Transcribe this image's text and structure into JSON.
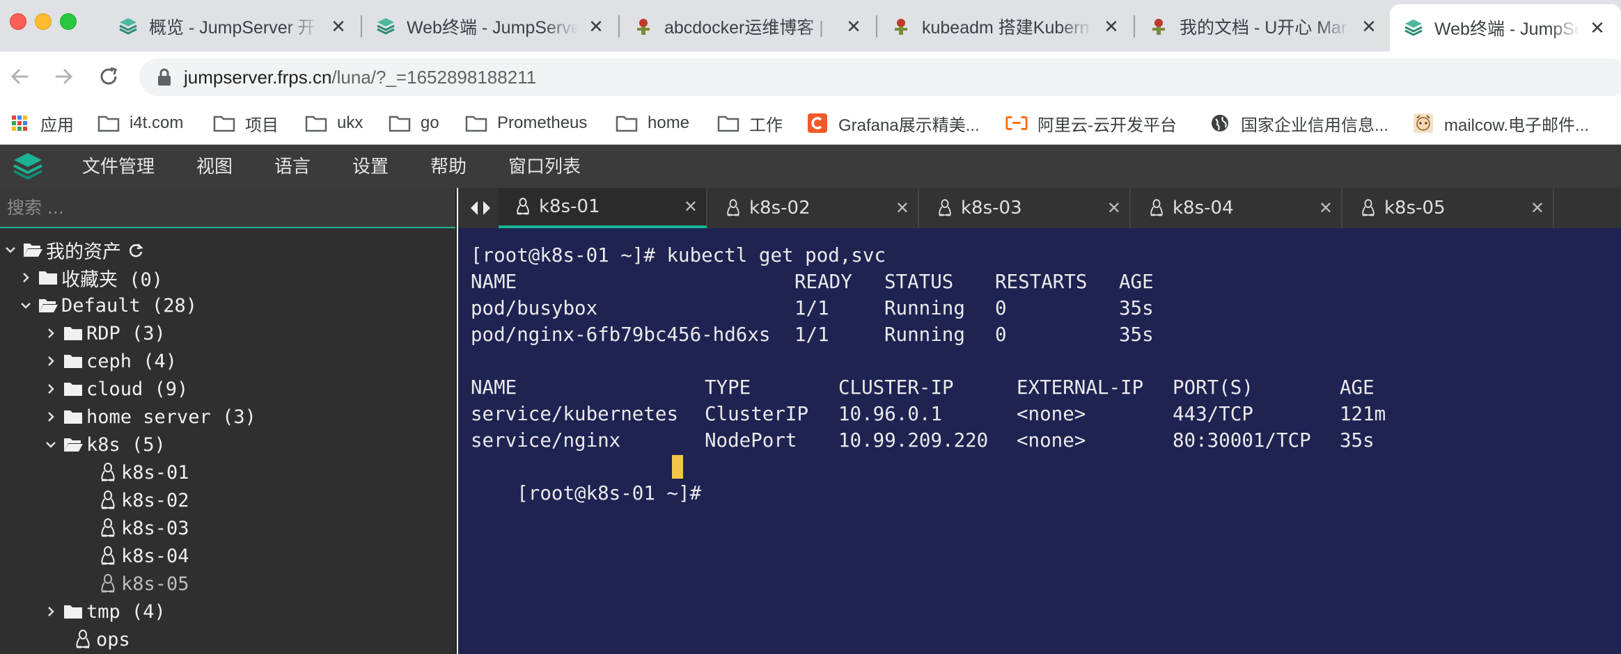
{
  "browser": {
    "tabs": [
      {
        "title": "概览 - JumpServer 开",
        "icon": "jumpserver-logo-icon"
      },
      {
        "title": "Web终端 - JumpServer",
        "icon": "jumpserver-logo-icon"
      },
      {
        "title": "abcdocker运维博客 |",
        "icon": "abcdocker-icon"
      },
      {
        "title": "kubeadm 搭建Kubern",
        "icon": "abcdocker-icon"
      },
      {
        "title": "我的文档 - U开心 Mar",
        "icon": "abcdocker-icon"
      },
      {
        "title": "Web终端 - JumpServ",
        "icon": "jumpserver-logo-icon",
        "active": true
      }
    ],
    "close_glyph": "✕",
    "url_host": "jumpserver.frps.cn",
    "url_path": "/luna/?_=1652898188211",
    "bookmarks": [
      {
        "label": "应用",
        "icon": "apps-grid-icon"
      },
      {
        "label": "i4t.com",
        "icon": "folder-icon"
      },
      {
        "label": "项目",
        "icon": "folder-icon"
      },
      {
        "label": "ukx",
        "icon": "folder-icon"
      },
      {
        "label": "go",
        "icon": "folder-icon"
      },
      {
        "label": "Prometheus",
        "icon": "folder-icon"
      },
      {
        "label": "home",
        "icon": "folder-icon"
      },
      {
        "label": "工作",
        "icon": "folder-icon"
      },
      {
        "label": "Grafana展示精美...",
        "icon": "grafana-icon"
      },
      {
        "label": "阿里云-云开发平台",
        "icon": "aliyun-icon"
      },
      {
        "label": "国家企业信用信息...",
        "icon": "globe-icon"
      },
      {
        "label": "mailcow.电子邮件...",
        "icon": "mailcow-icon"
      }
    ]
  },
  "app": {
    "menu": [
      "文件管理",
      "视图",
      "语言",
      "设置",
      "帮助",
      "窗口列表"
    ]
  },
  "sidebar": {
    "search_placeholder": "搜索 ...",
    "tree": [
      {
        "label": "我的资产",
        "type": "root",
        "expanded": true
      },
      {
        "label": "收藏夹 (0)",
        "type": "folder",
        "expanded": false
      },
      {
        "label": "Default (28)",
        "type": "folder",
        "expanded": true
      },
      {
        "label": "RDP (3)",
        "type": "folder",
        "expanded": false
      },
      {
        "label": "ceph (4)",
        "type": "folder",
        "expanded": false
      },
      {
        "label": "cloud (9)",
        "type": "folder",
        "expanded": false
      },
      {
        "label": "home server (3)",
        "type": "folder",
        "expanded": false
      },
      {
        "label": "k8s (5)",
        "type": "folder",
        "expanded": true
      },
      {
        "label": "k8s-01",
        "type": "host"
      },
      {
        "label": "k8s-02",
        "type": "host"
      },
      {
        "label": "k8s-03",
        "type": "host"
      },
      {
        "label": "k8s-04",
        "type": "host"
      },
      {
        "label": "k8s-05",
        "type": "host"
      },
      {
        "label": "tmp (4)",
        "type": "folder",
        "expanded": false
      },
      {
        "label": "ops",
        "type": "host"
      }
    ]
  },
  "terminal": {
    "tabs": [
      {
        "label": "k8s-01",
        "active": true
      },
      {
        "label": "k8s-02"
      },
      {
        "label": "k8s-03"
      },
      {
        "label": "k8s-04"
      },
      {
        "label": "k8s-05"
      }
    ],
    "tab_close_glyph": "✕",
    "command_line": "[root@k8s-01 ~]# kubectl get pod,svc",
    "pods": {
      "headers": [
        "NAME",
        "READY",
        "STATUS",
        "RESTARTS",
        "AGE"
      ],
      "rows": [
        [
          "pod/busybox",
          "1/1",
          "Running",
          "0",
          "35s"
        ],
        [
          "pod/nginx-6fb79bc456-hd6xs",
          "1/1",
          "Running",
          "0",
          "35s"
        ]
      ]
    },
    "services": {
      "headers": [
        "NAME",
        "TYPE",
        "CLUSTER-IP",
        "EXTERNAL-IP",
        "PORT(S)",
        "AGE"
      ],
      "rows": [
        [
          "service/kubernetes",
          "ClusterIP",
          "10.96.0.1",
          "<none>",
          "443/TCP",
          "121m"
        ],
        [
          "service/nginx",
          "NodePort",
          "10.99.209.220",
          "<none>",
          "80:30001/TCP",
          "35s"
        ]
      ]
    },
    "prompt": "[root@k8s-01 ~]# ",
    "cursor_color": "#f0c64a",
    "background_color": "#1e2352"
  },
  "colors": {
    "accent": "#1ab394",
    "menubar": "#3b3b3b",
    "sidebar": "#2f2f2f"
  }
}
